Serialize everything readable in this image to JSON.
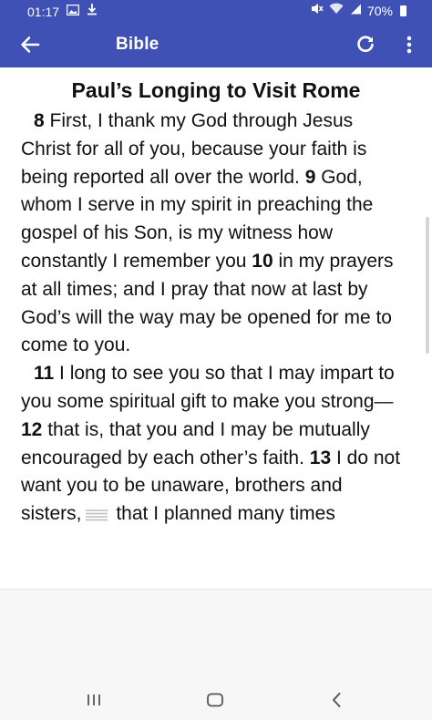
{
  "status_bar": {
    "time": "01:17",
    "battery": "70%",
    "icons": [
      "gallery-icon",
      "download-icon",
      "mute-icon",
      "wifi-icon",
      "signal-icon",
      "battery-icon"
    ]
  },
  "app_bar": {
    "title": "Bible",
    "back_icon": "back-arrow-icon",
    "refresh_icon": "refresh-icon",
    "more_icon": "more-vertical-icon",
    "color": "#3f51b5"
  },
  "passage": {
    "heading": "Paul’s Longing to Visit Rome",
    "paragraphs": [
      [
        {
          "verse": "8",
          "text": " First, I thank my God through Jesus Christ for all of you, because your faith is being reported all over the world. "
        },
        {
          "verse": "9",
          "text": " God, whom I serve in my spirit in preaching the gospel of his Son, is my witness how constantly I remember you "
        },
        {
          "verse": "10",
          "text": " in my prayers at all times; and I pray that now at last by God’s will the way may be opened for me to come to you."
        }
      ],
      [
        {
          "verse": "11",
          "text": " I long to see you so that I may impart to you some spiritual gift to make you strong— "
        },
        {
          "verse": "12",
          "text": " that is, that you and I may be mutually encouraged by each other’s faith. "
        },
        {
          "verse": "13",
          "text": " I do not want you to be unaware, brothers and sisters,",
          "footnote": true,
          "after": " that I planned many times"
        }
      ]
    ]
  },
  "nav_bar": {
    "recents_icon": "recent-apps-icon",
    "home_icon": "home-icon",
    "back_icon": "back-chevron-icon"
  }
}
